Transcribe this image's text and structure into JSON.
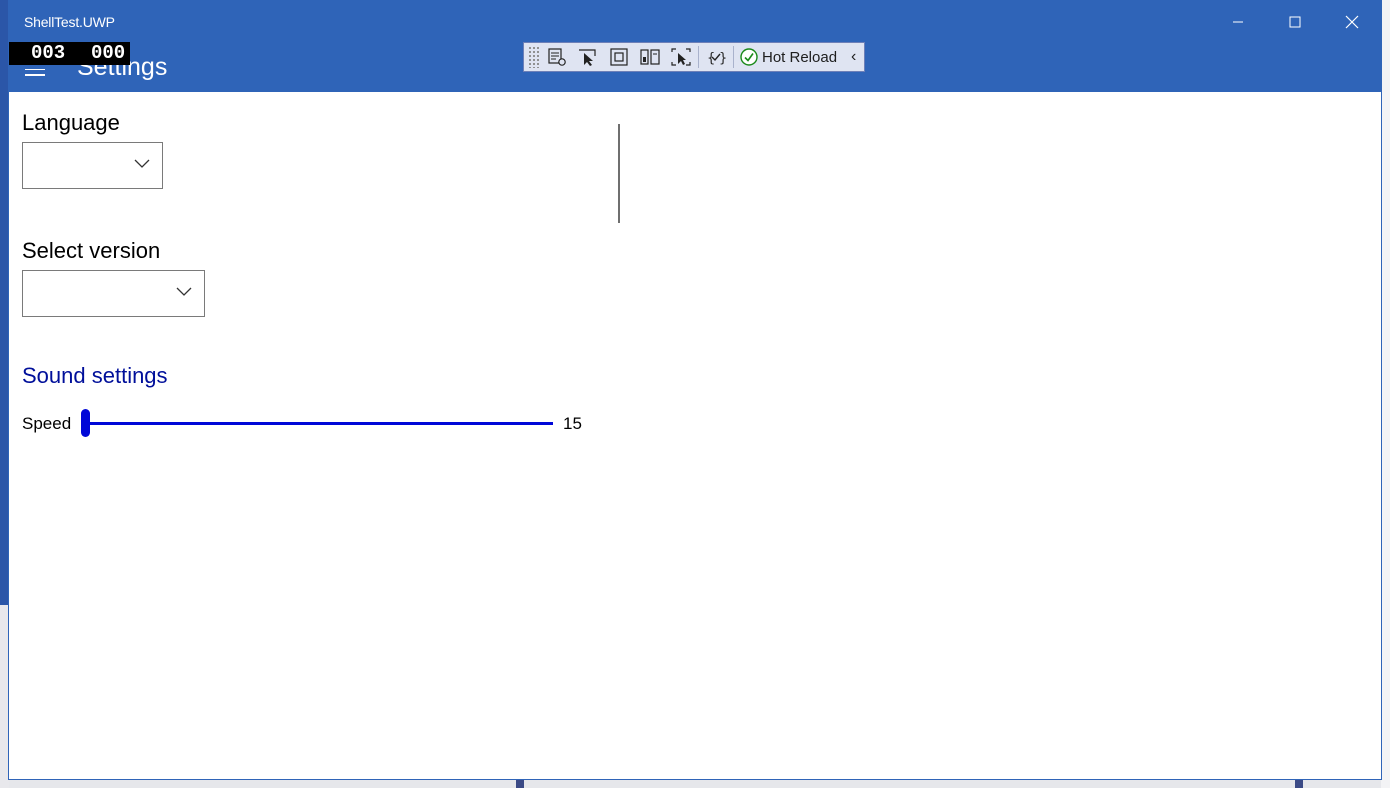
{
  "window": {
    "title": "ShellTest.UWP",
    "controls": [
      "minimize-icon",
      "maximize-icon",
      "close-icon"
    ]
  },
  "fps_counter": {
    "left": "003",
    "right": "000"
  },
  "page": {
    "title": "Settings"
  },
  "debug_toolbar": {
    "tools": [
      "live-visual-tree-icon",
      "select-element-icon",
      "display-layout-adorners-icon",
      "track-focus-icon",
      "binding-failures-icon",
      "xaml-binding-icon"
    ],
    "hot_reload_label": "Hot Reload",
    "collapse_glyph": "‹"
  },
  "settings": {
    "language_label": "Language",
    "language_value": "",
    "version_label": "Select version",
    "version_value": "",
    "sound_section": "Sound settings",
    "speed_label": "Speed",
    "speed_value": "15"
  },
  "colors": {
    "titlebar": "#2f64b8",
    "accent_section": "#000f9a",
    "slider": "#0007d8"
  }
}
